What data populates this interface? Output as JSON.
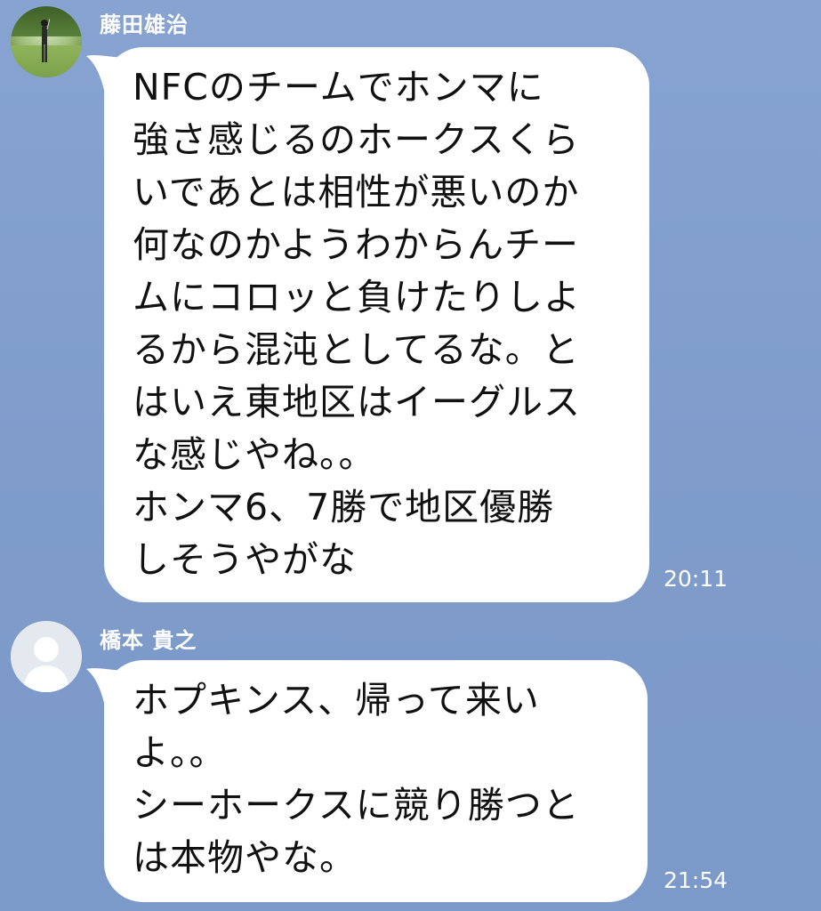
{
  "chat": {
    "messages": [
      {
        "sender": "藤田雄治",
        "avatar": "golf-photo-avatar",
        "text": "NFCのチームでホンマに\n強さ感じるのホークスくら\nいであとは相性が悪いのか\n何なのかようわからんチー\nムにコロッと負けたりしよ\nるから混沌としてるな。と\nはいえ東地区はイーグルス\nな感じやね。。\nホンマ6、7勝で地区優勝\nしそうやがな",
        "time": "20:11"
      },
      {
        "sender": "橋本 貴之",
        "avatar": "default-person-avatar",
        "text": "ホプキンス、帰って来い\nよ。。\nシーホークスに競り勝つと\nは本物やな。",
        "time": "21:54"
      }
    ]
  },
  "colors": {
    "background": "#7f9ccb",
    "bubble": "#ffffff",
    "text": "#111111",
    "meta_text": "#ffffff"
  }
}
